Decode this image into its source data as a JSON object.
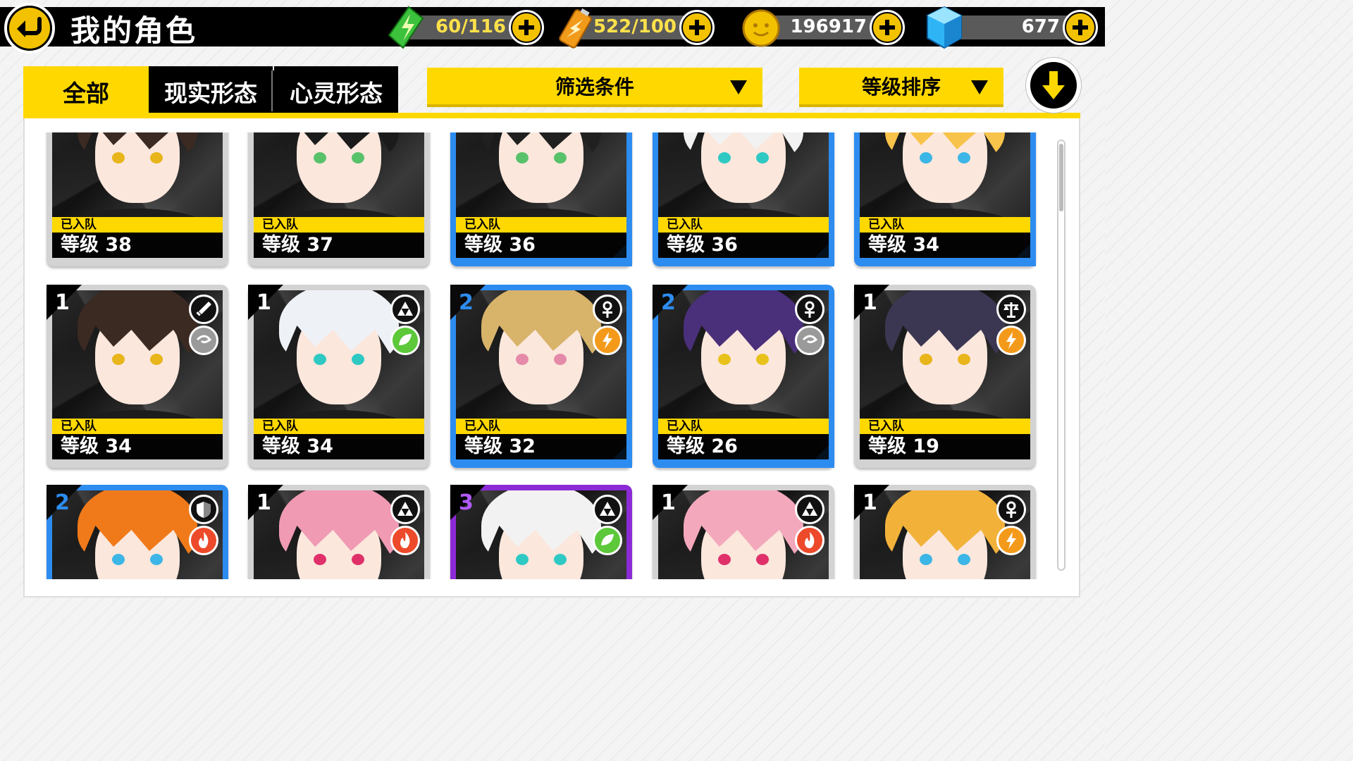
{
  "header": {
    "title": "我的角色"
  },
  "resources": {
    "stamina": {
      "value": "60/116",
      "icon": "green-crystal-icon",
      "color": "#3cc13c"
    },
    "battery": {
      "value": "522/100",
      "icon": "battery-icon",
      "color": "#f29a1a"
    },
    "coins": {
      "value": "196917",
      "icon": "gold-coin-icon",
      "color": "#f2c200"
    },
    "gems": {
      "value": "677",
      "icon": "blue-cube-icon",
      "color": "#2fb5f5"
    }
  },
  "tabs": [
    {
      "label": "全部",
      "active": true
    },
    {
      "label": "现实形态",
      "active": false
    },
    {
      "label": "心灵形态",
      "active": false
    }
  ],
  "filters": {
    "filter_label": "筛选条件",
    "sort_label": "等级排序"
  },
  "team_label": "已入队",
  "colors": {
    "accent": "#ffd800",
    "blue_frame": "#2d8cf0",
    "purple_frame": "#8c2bd6",
    "grey_frame": "#d3d3d3"
  },
  "cards": [
    {
      "level": "等级 38",
      "rank": "",
      "frame": "grey",
      "attrs": [
        "wind"
      ],
      "in_team": true,
      "hair": "#3b2a22",
      "eye": "#e8b51a"
    },
    {
      "level": "等级 37",
      "rank": "",
      "frame": "grey",
      "attrs": [
        "water"
      ],
      "in_team": true,
      "hair": "#1b1b1b",
      "eye": "#58c26a"
    },
    {
      "level": "等级 36",
      "rank": "",
      "frame": "blue",
      "attrs": [
        "water"
      ],
      "in_team": true,
      "hair": "#202020",
      "eye": "#58c26a"
    },
    {
      "level": "等级 36",
      "rank": "",
      "frame": "blue",
      "attrs": [
        "leaf"
      ],
      "in_team": true,
      "hair": "#f2f2f2",
      "eye": "#2fc9c4"
    },
    {
      "level": "等级 34",
      "rank": "",
      "frame": "blue",
      "attrs": [
        "lightning"
      ],
      "in_team": true,
      "hair": "#f8c34a",
      "eye": "#3cb6e6"
    },
    {
      "level": "等级 34",
      "rank": "1",
      "frame": "grey",
      "attrs": [
        "sword",
        "wind"
      ],
      "in_team": true,
      "hair": "#3b2a22",
      "eye": "#e8b51a"
    },
    {
      "level": "等级 34",
      "rank": "1",
      "frame": "grey",
      "attrs": [
        "triforce",
        "leaf"
      ],
      "in_team": true,
      "hair": "#eef1f6",
      "eye": "#2fc9c4"
    },
    {
      "level": "等级 32",
      "rank": "2",
      "frame": "blue",
      "attrs": [
        "ankh",
        "lightning"
      ],
      "in_team": true,
      "hair": "#d8b36a",
      "eye": "#e58aa8"
    },
    {
      "level": "等级 26",
      "rank": "2",
      "frame": "blue",
      "attrs": [
        "ankh",
        "wind"
      ],
      "in_team": true,
      "hair": "#4a2f7a",
      "eye": "#e8c21a"
    },
    {
      "level": "等级 19",
      "rank": "1",
      "frame": "grey",
      "attrs": [
        "scales",
        "lightning"
      ],
      "in_team": true,
      "hair": "#3b3652",
      "eye": "#e8b51a"
    },
    {
      "level": "",
      "rank": "2",
      "frame": "blue",
      "attrs": [
        "shield",
        "fire"
      ],
      "in_team": false,
      "hair": "#f07a1a",
      "eye": "#3cb6e6"
    },
    {
      "level": "",
      "rank": "1",
      "frame": "grey",
      "attrs": [
        "triforce",
        "fire"
      ],
      "in_team": false,
      "hair": "#f09ab4",
      "eye": "#e0306a"
    },
    {
      "level": "",
      "rank": "3",
      "frame": "purple",
      "attrs": [
        "triforce",
        "leaf"
      ],
      "in_team": false,
      "hair": "#f2f2f2",
      "eye": "#2fc9c4"
    },
    {
      "level": "",
      "rank": "1",
      "frame": "grey",
      "attrs": [
        "triforce",
        "fire"
      ],
      "in_team": false,
      "hair": "#f4a8bc",
      "eye": "#e0306a"
    },
    {
      "level": "",
      "rank": "1",
      "frame": "grey",
      "attrs": [
        "ankh",
        "lightning"
      ],
      "in_team": false,
      "hair": "#f2b23a",
      "eye": "#3cb6e6"
    }
  ]
}
